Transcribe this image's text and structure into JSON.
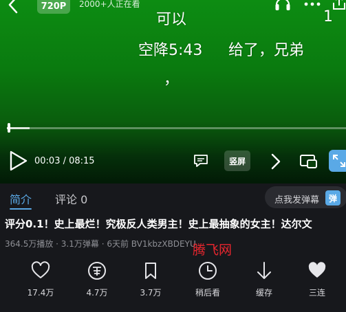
{
  "top_bar": {
    "quality": "720P",
    "viewers": "2000+人正在看",
    "icons": [
      "back-icon",
      "headphone-icon",
      "more-icon",
      "share-icon"
    ]
  },
  "danmaku": [
    "可以",
    "空降5:43",
    "给了，兄弟",
    "，",
    "1"
  ],
  "player": {
    "progress": 0.067,
    "time": "00:03 / 08:15",
    "vertical_label": "竖屏",
    "accent": "#5aa9e6"
  },
  "tabs": {
    "intro": "简介",
    "comments": "评论 0"
  },
  "danmaku_input": {
    "label": "点我发弹幕",
    "badge": "弹"
  },
  "video": {
    "title": "评分0.1！史上最烂！究极反人类男主！史上最抽象的女主！达尔文",
    "meta": "364.5万播放 · 3.1万弹幕 · 6天前   BV1kbzXBDEYU"
  },
  "watermark": "腾飞网",
  "actions": [
    {
      "icon": "heart-outline-icon",
      "label": "17.4万"
    },
    {
      "icon": "coin-icon",
      "label": "4.7万"
    },
    {
      "icon": "bookmark-icon",
      "label": "3.7万"
    },
    {
      "icon": "clock-icon",
      "label": "稍后看"
    },
    {
      "icon": "download-arrow-icon",
      "label": "缓存"
    },
    {
      "icon": "heart-filled-icon",
      "label": "三连"
    }
  ]
}
